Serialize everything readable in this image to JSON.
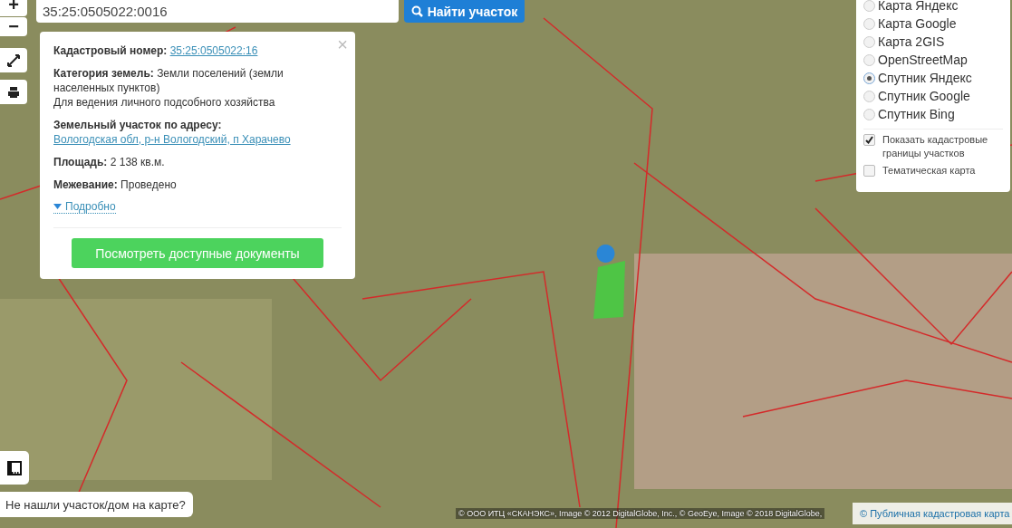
{
  "search": {
    "value": "35:25:0505022:0016",
    "button": "Найти участок"
  },
  "map_controls": [
    "+",
    "−"
  ],
  "popup": {
    "close": "×",
    "fields": [
      {
        "label": "Кадастровый номер:",
        "kind": "link",
        "value": "35:25:0505022:16"
      },
      {
        "label": "Категория земель:",
        "kind": "text",
        "value": "Земли поселений (земли населенных пунктов)\nДля ведения личного подсобного хозяйства"
      },
      {
        "label": "Земельный участок по адресу:",
        "kind": "link",
        "value": "Вологодская обл, р-н Вологодский, п Харачево"
      },
      {
        "label": "Площадь:",
        "kind": "text",
        "value": "2 138 кв.м."
      },
      {
        "label": "Межевание:",
        "kind": "text",
        "value": "Проведено"
      }
    ],
    "more": "Подробно",
    "expanded": false,
    "action": "Посмотреть доступные документы"
  },
  "layers": [
    {
      "label": "Карта Яндекс",
      "selected": false
    },
    {
      "label": "Карта Google",
      "selected": false
    },
    {
      "label": "Карта 2GIS",
      "selected": false
    },
    {
      "label": "OpenStreetMap",
      "selected": false
    },
    {
      "label": "Спутник Яндекс",
      "selected": true
    },
    {
      "label": "Спутник Google",
      "selected": false
    },
    {
      "label": "Спутник Bing",
      "selected": false
    }
  ],
  "options": [
    {
      "label": "Показать кадастровые границы участков",
      "checked": true
    },
    {
      "label": "Тематическая карта",
      "checked": false
    }
  ],
  "help": "Не нашли участок/дом на карте?",
  "attribution": "© ООО ИТЦ «СКАНЭКС», Image © 2012 DigitalGlobe, Inc., © GeoEye, Image © 2018 DigitalGlobe,",
  "source_link": "© Публичная кадастровая карта"
}
